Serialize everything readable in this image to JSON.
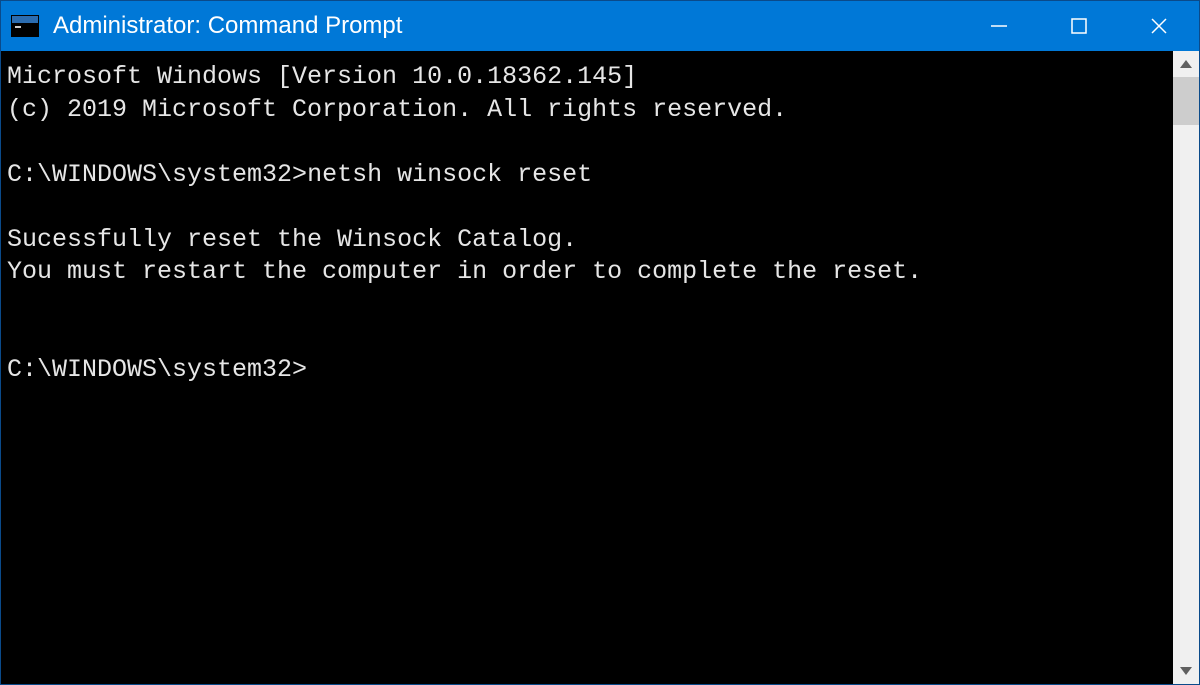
{
  "window": {
    "title": "Administrator: Command Prompt"
  },
  "terminal": {
    "header_line1": "Microsoft Windows [Version 10.0.18362.145]",
    "header_line2": "(c) 2019 Microsoft Corporation. All rights reserved.",
    "prompt1_path": "C:\\WINDOWS\\system32>",
    "command1": "netsh winsock reset",
    "output_line1": "Sucessfully reset the Winsock Catalog.",
    "output_line2": "You must restart the computer in order to complete the reset.",
    "prompt2_path": "C:\\WINDOWS\\system32>"
  },
  "colors": {
    "titlebar_bg": "#0078d7",
    "terminal_bg": "#000000",
    "terminal_fg": "#e6e6e6"
  }
}
